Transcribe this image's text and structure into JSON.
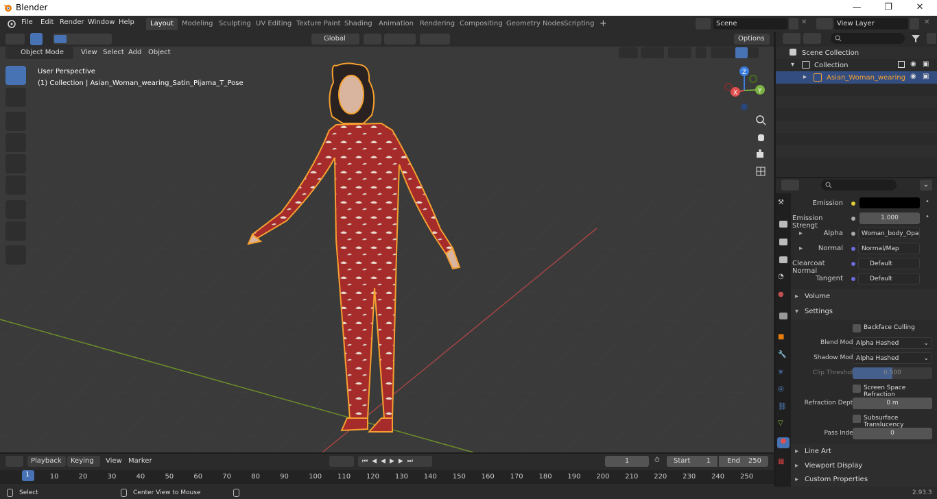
{
  "window": {
    "title": "Blender",
    "minimize": "—",
    "maximize": "❐",
    "close": "✕"
  },
  "menus": [
    "File",
    "Edit",
    "Render",
    "Window",
    "Help"
  ],
  "workspaces": [
    "Layout",
    "Modeling",
    "Sculpting",
    "UV Editing",
    "Texture Paint",
    "Shading",
    "Animation",
    "Rendering",
    "Compositing",
    "Geometry Nodes",
    "Scripting"
  ],
  "active_workspace": "Layout",
  "scene": {
    "name": "Scene",
    "view_layer": "View Layer"
  },
  "viewport": {
    "mode": "Object Mode",
    "menus": [
      "View",
      "Select",
      "Add",
      "Object"
    ],
    "transform_orientation": "Global",
    "options_label": "Options",
    "perspective_label": "User Perspective",
    "collection_label": "(1) Collection | Asian_Woman_wearing_Satin_Pijama_T_Pose",
    "gizmo": {
      "x": "X",
      "y": "Y",
      "z": "Z"
    }
  },
  "outliner": {
    "scene_collection": "Scene Collection",
    "collection": "Collection",
    "object": "Asian_Woman_wearing_S"
  },
  "properties": {
    "emission_label": "Emission",
    "emission_color": "#000000",
    "emission_strength_label": "Emission Strengt",
    "emission_strength": "1.000",
    "alpha_label": "Alpha",
    "alpha_value": "Woman_body_Opac...",
    "normal_label": "Normal",
    "normal_value": "Normal/Map",
    "clearcoat_label": "Clearcoat Normal",
    "clearcoat_value": "Default",
    "tangent_label": "Tangent",
    "tangent_value": "Default",
    "volume_section": "Volume",
    "settings_section": "Settings",
    "backface_label": "Backface Culling",
    "blend_mode_label": "Blend Mode",
    "blend_mode_value": "Alpha Hashed",
    "shadow_mode_label": "Shadow Mode",
    "shadow_mode_value": "Alpha Hashed",
    "clip_label": "Clip Threshold",
    "clip_value": "0.500",
    "ssr_label": "Screen Space Refraction",
    "refraction_depth_label": "Refraction Depth",
    "refraction_depth_value": "0 m",
    "sss_label": "Subsurface Translucency",
    "pass_index_label": "Pass Index",
    "pass_index_value": "0",
    "lineart_section": "Line Art",
    "viewport_display_section": "Viewport Display",
    "custom_props_section": "Custom Properties"
  },
  "timeline": {
    "menus": [
      "Playback",
      "Keying",
      "View",
      "Marker"
    ],
    "current_frame": "1",
    "start_label": "Start",
    "start_value": "1",
    "end_label": "End",
    "end_value": "250",
    "ticks": [
      "1",
      "10",
      "20",
      "30",
      "40",
      "50",
      "60",
      "70",
      "80",
      "90",
      "100",
      "110",
      "120",
      "130",
      "140",
      "150",
      "160",
      "170",
      "180",
      "190",
      "200",
      "210",
      "220",
      "230",
      "240",
      "250"
    ]
  },
  "status": {
    "select": "Select",
    "center_view": "Center View to Mouse",
    "version": "2.93.3"
  },
  "colors": {
    "accent": "#4772b3",
    "selection": "#f5a030",
    "x_axis": "#e05050",
    "y_axis": "#7cb342",
    "z_axis": "#3d7fe0"
  }
}
